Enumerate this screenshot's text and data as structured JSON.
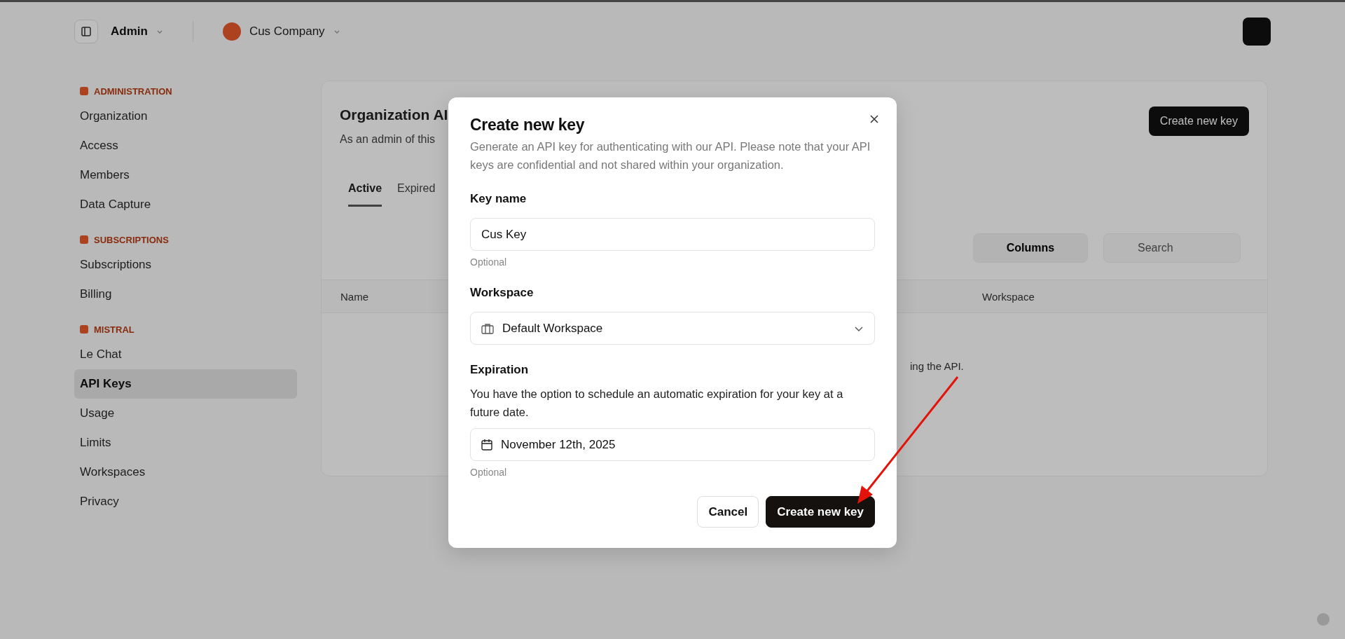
{
  "topbar": {
    "workspace": "Admin",
    "company": "Cus Company"
  },
  "sidebar": {
    "sections": [
      {
        "title": "ADMINISTRATION",
        "items": [
          {
            "label": "Organization",
            "selected": false
          },
          {
            "label": "Access",
            "selected": false
          },
          {
            "label": "Members",
            "selected": false
          },
          {
            "label": "Data Capture",
            "selected": false
          }
        ]
      },
      {
        "title": "SUBSCRIPTIONS",
        "items": [
          {
            "label": "Subscriptions",
            "selected": false
          },
          {
            "label": "Billing",
            "selected": false
          }
        ]
      },
      {
        "title": "MISTRAL",
        "items": [
          {
            "label": "Le Chat",
            "selected": false
          },
          {
            "label": "API Keys",
            "selected": true
          },
          {
            "label": "Usage",
            "selected": false
          },
          {
            "label": "Limits",
            "selected": false
          },
          {
            "label": "Workspaces",
            "selected": false
          },
          {
            "label": "Privacy",
            "selected": false
          }
        ]
      }
    ]
  },
  "main": {
    "title": "Organization AI",
    "subtitle": "As an admin of this",
    "create_button": "Create new key",
    "tabs": [
      {
        "label": "Active",
        "selected": true
      },
      {
        "label": "Expired",
        "selected": false
      }
    ],
    "columns_button": "Columns",
    "search": {
      "placeholder": "Search"
    },
    "table": {
      "columns": [
        "Name",
        "Workspace"
      ],
      "empty_text": "ing the API."
    }
  },
  "dialog": {
    "title": "Create new key",
    "description": "Generate an API key for authenticating with our API. Please note that your API keys are confidential and not shared within your organization.",
    "fields": [
      {
        "kind": "text",
        "label": "Key name",
        "value": "Cus Key",
        "hint": "Optional"
      },
      {
        "kind": "select",
        "label": "Workspace",
        "value": "Default Workspace"
      },
      {
        "kind": "date",
        "label": "Expiration",
        "description": "You have the option to schedule an automatic expiration for your key at a future date.",
        "value": "November 12th, 2025",
        "hint": "Optional"
      }
    ],
    "buttons": [
      {
        "label": "Cancel",
        "kind": "secondary"
      },
      {
        "label": "Create new key",
        "kind": "primary"
      }
    ]
  }
}
